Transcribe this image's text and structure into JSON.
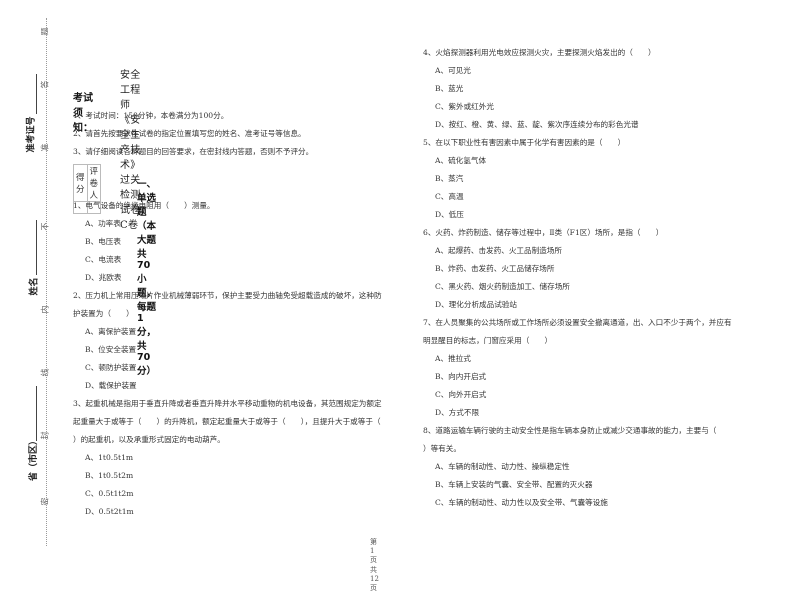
{
  "binding": {
    "seal_chars": [
      "题",
      "答",
      "准",
      "不",
      "内",
      "线",
      "封",
      "密"
    ],
    "fields": [
      {
        "label": "准考证号"
      },
      {
        "label": "姓名"
      },
      {
        "label": "省（市区）"
      }
    ]
  },
  "exam": {
    "title": "安全工程师《安全生产技术》过关检测试卷C卷",
    "notice_heading": "考试须知：",
    "notices": [
      "1、考试时间：150分钟，本卷满分为100分。",
      "2、请首先按要求在试卷的指定位置填写您的姓名、准考证号等信息。",
      "3、请仔细阅读各种题目的回答要求，在密封线内答题，否则不予评分。"
    ],
    "score_table": {
      "score_label": "得分",
      "grader_label": "评卷人"
    },
    "section_heading": "一、单选题（本大题共70小题，每题1分，共70分）"
  },
  "questions": [
    {
      "lines": [
        "1、电气设备的绝缘电阻用（　　）测量。"
      ],
      "options": [
        "A、功率表",
        "B、电压表",
        "C、电流表",
        "D、兆欧表"
      ]
    },
    {
      "lines": [
        "2、压力机上常用压塌片作业机械薄弱环节，保护主要受力曲轴免受超载造成的破坏，这种防",
        "护装置为（　　）"
      ],
      "options": [
        "A、离保护装置",
        "B、位安全装置",
        "C、顿防护装置",
        "D、载保护装置"
      ]
    },
    {
      "lines": [
        "3、起重机械是指用于垂直升降或者垂直升降并水平移动重物的机电设备，其范围规定为额定",
        "起重量大于或等于（　　）的升降机，额定起重量大于或等于（　　），且提升大于或等于（",
        "）的起重机，以及承重形式固定的电动葫芦。"
      ],
      "options": [
        "A、1t0.5t1m",
        "B、1t0.5t2m",
        "C、0.5t1t2m",
        "D、0.5t2t1m"
      ]
    },
    {
      "lines": [
        "4、火焰探测器利用光电效应探测火灾，主要探测火焰发出的（　　）"
      ],
      "options": [
        "A、可见光",
        "B、蓝光",
        "C、紫外或红外光",
        "D、按红、橙、黄、绿、蓝、靛、紫次序连续分布的彩色光谱"
      ]
    },
    {
      "lines": [
        "5、在以下职业性有害因素中属于化学有害因素的是（　　）"
      ],
      "options": [
        "A、硫化氢气体",
        "B、蒸汽",
        "C、高温",
        "D、低压"
      ]
    },
    {
      "lines": [
        "6、火药、炸药制造、储存等过程中，Ⅱ类（F1区）场所，是指（　　）"
      ],
      "options": [
        "A、起爆药、击发药、火工品制造场所",
        "B、炸药、击发药、火工品储存场所",
        "C、黑火药、烟火药制造加工、储存场所",
        "D、理化分析成品试验站"
      ]
    },
    {
      "lines": [
        "7、在人员聚集的公共场所或工作场所必须设置安全撤离通道，出、入口不少于两个，并应有",
        "明显醒目的标志，门窗应采用（　　）"
      ],
      "options": [
        "A、推拉式",
        "B、向内开启式",
        "C、向外开启式",
        "D、方式不限"
      ]
    },
    {
      "lines": [
        "8、道路运输车辆行驶的主动安全性是指车辆本身防止或减少交通事故的能力，主要与（",
        "）等有关。"
      ],
      "options": [
        "A、车辆的制动性、动力性、操纵稳定性",
        "B、车辆上安装的气囊、安全带、配置的灭火器",
        "C、车辆的制动性、动力性以及安全带、气囊等设施"
      ]
    }
  ],
  "footer": {
    "page_text": "第 1 页 共 12 页"
  }
}
